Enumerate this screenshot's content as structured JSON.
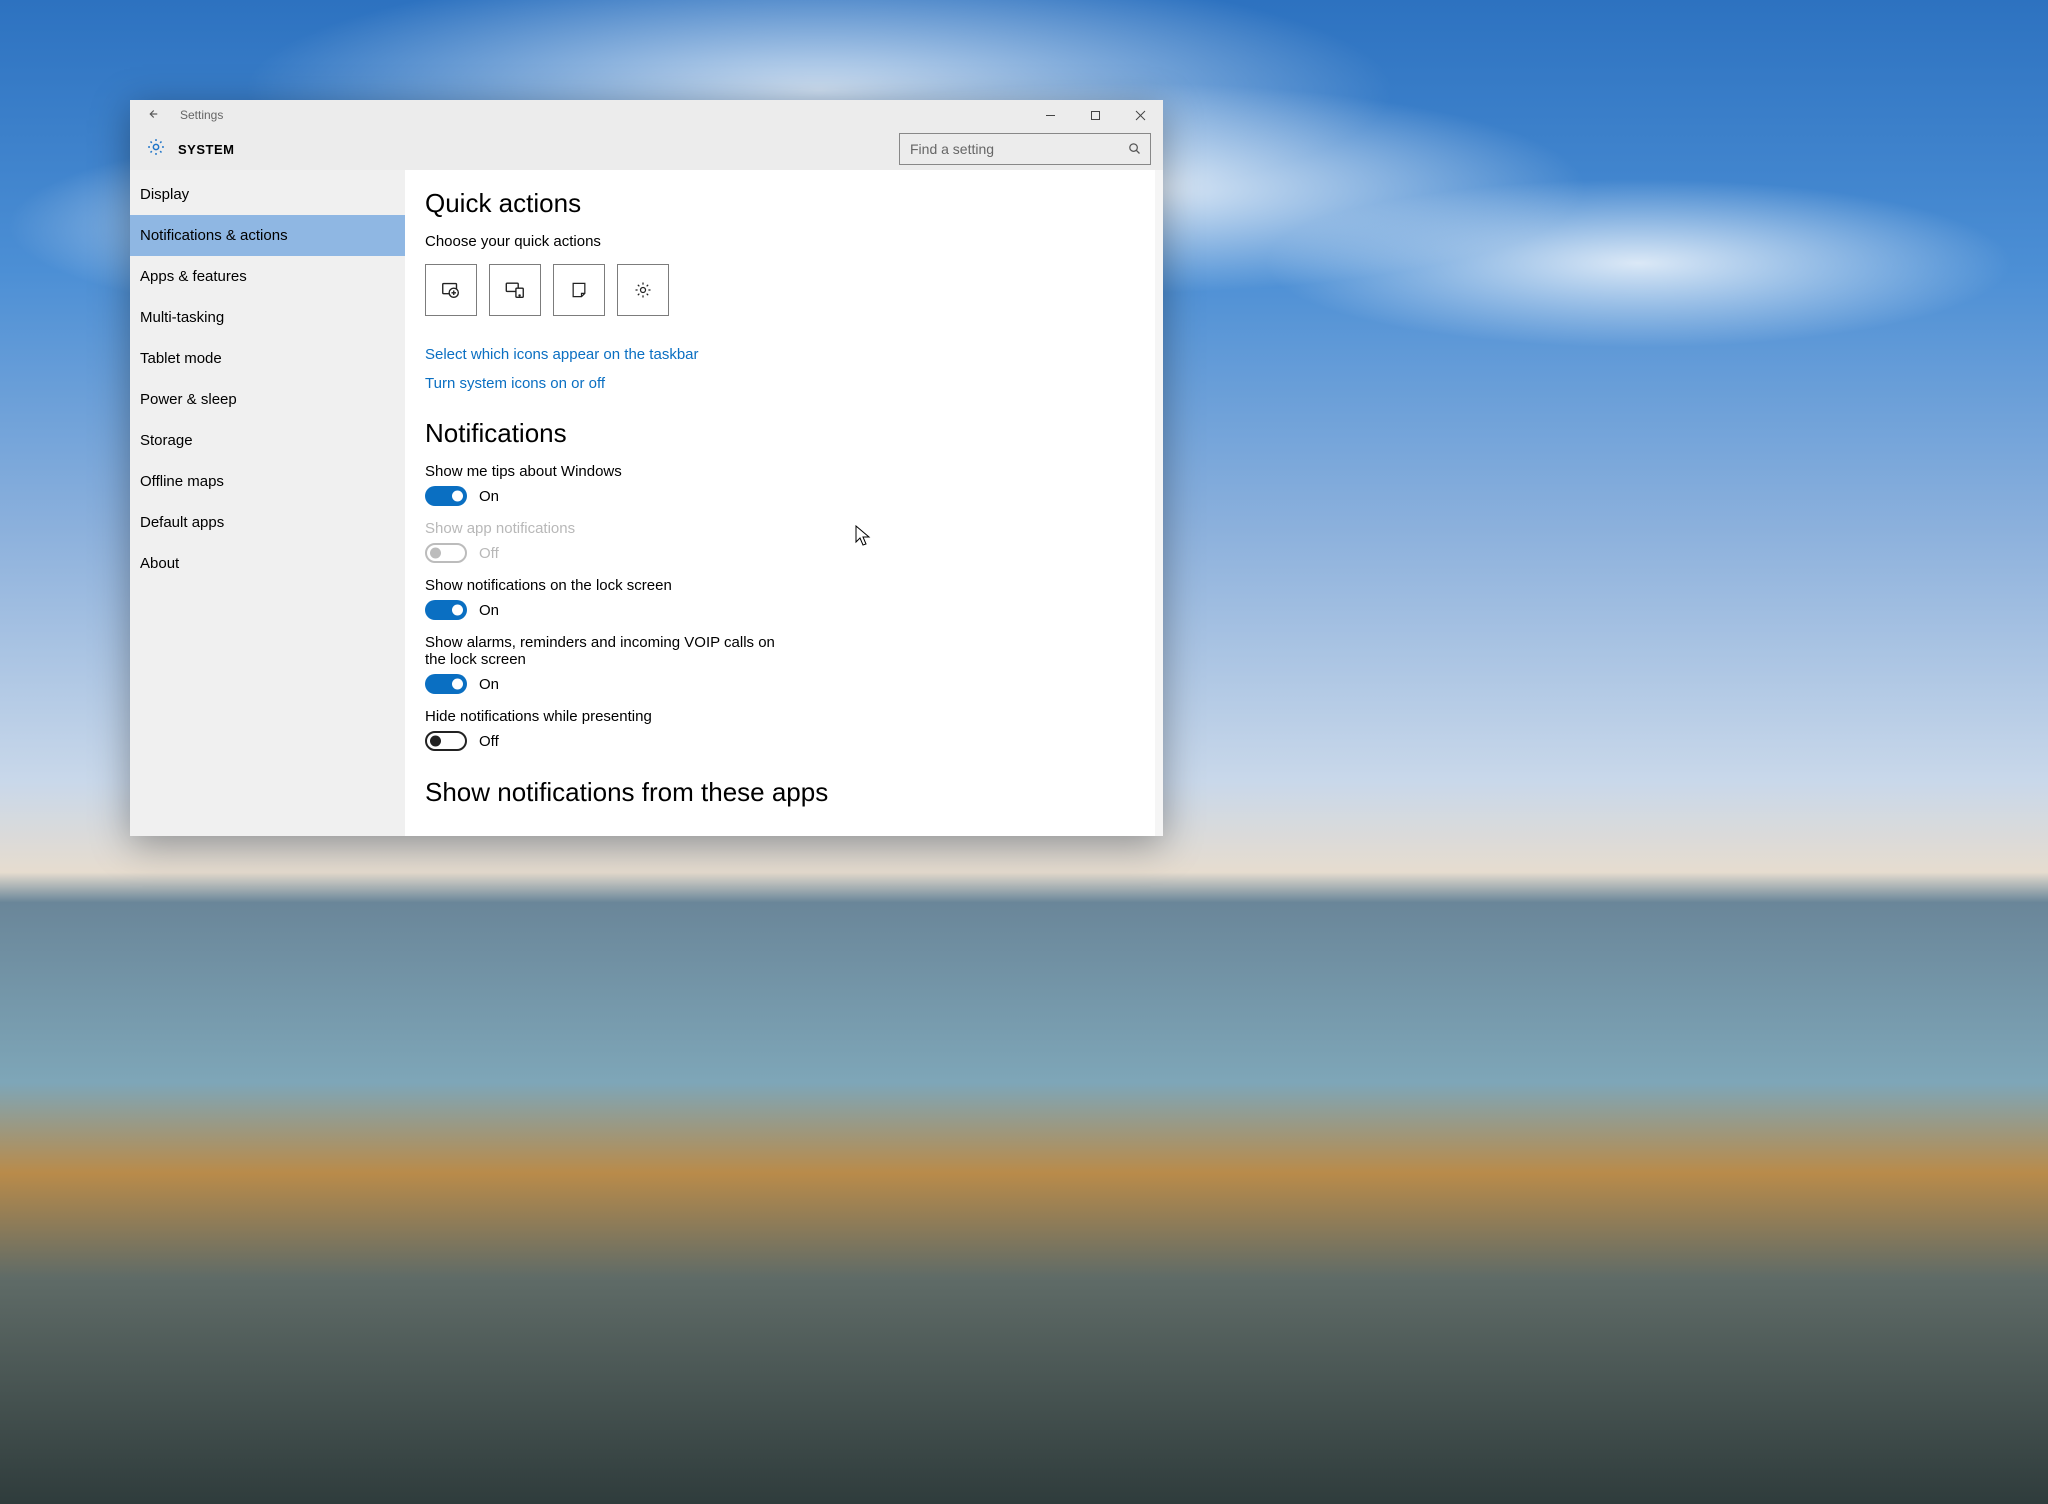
{
  "window": {
    "title": "Settings"
  },
  "header": {
    "heading": "SYSTEM"
  },
  "search": {
    "placeholder": "Find a setting"
  },
  "sidebar": {
    "items": [
      {
        "label": "Display"
      },
      {
        "label": "Notifications & actions"
      },
      {
        "label": "Apps & features"
      },
      {
        "label": "Multi-tasking"
      },
      {
        "label": "Tablet mode"
      },
      {
        "label": "Power & sleep"
      },
      {
        "label": "Storage"
      },
      {
        "label": "Offline maps"
      },
      {
        "label": "Default apps"
      },
      {
        "label": "About"
      }
    ],
    "active_index": 1
  },
  "quick_actions": {
    "heading": "Quick actions",
    "subtext": "Choose your quick actions",
    "tiles": [
      "tablet-mode",
      "connect",
      "note",
      "all-settings"
    ],
    "link_taskbar": "Select which icons appear on the taskbar",
    "link_sysicons": "Turn system icons on or off"
  },
  "notifications": {
    "heading": "Notifications",
    "toggles": [
      {
        "label": "Show me tips about Windows",
        "state": "On",
        "on": true,
        "disabled": false
      },
      {
        "label": "Show app notifications",
        "state": "Off",
        "on": false,
        "disabled": true
      },
      {
        "label": "Show notifications on the lock screen",
        "state": "On",
        "on": true,
        "disabled": false
      },
      {
        "label": "Show alarms, reminders and incoming VOIP calls on the lock screen",
        "state": "On",
        "on": true,
        "disabled": false
      },
      {
        "label": "Hide notifications while presenting",
        "state": "Off",
        "on": false,
        "disabled": false
      }
    ],
    "apps_heading": "Show notifications from these apps"
  }
}
